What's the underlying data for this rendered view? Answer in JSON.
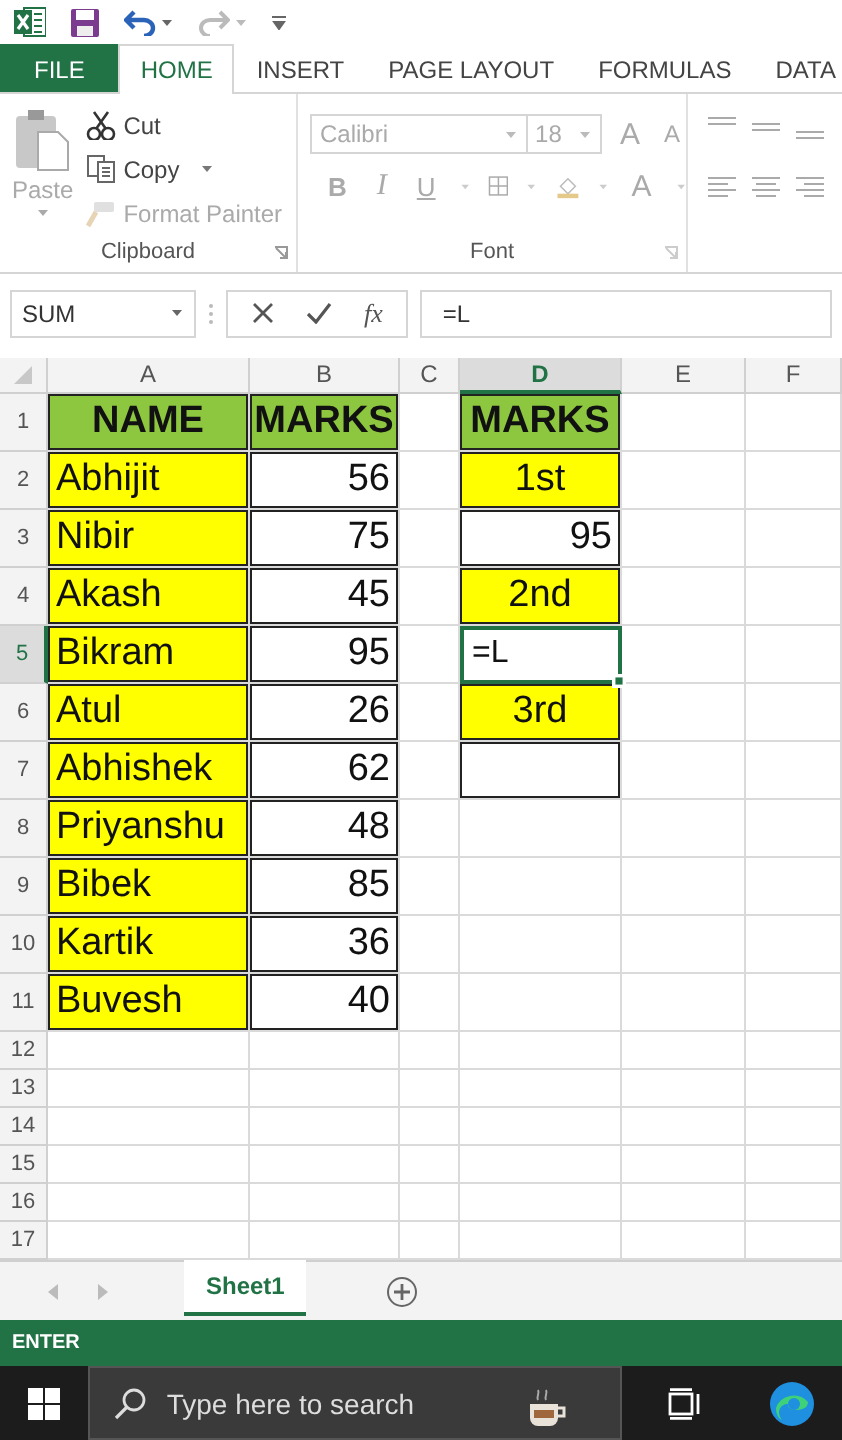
{
  "tabs": [
    {
      "label": "FILE",
      "kind": "file",
      "selected": false
    },
    {
      "label": "HOME",
      "kind": "tab",
      "selected": true
    },
    {
      "label": "INSERT",
      "kind": "tab",
      "selected": false
    },
    {
      "label": "PAGE LAYOUT",
      "kind": "tab",
      "selected": false
    },
    {
      "label": "FORMULAS",
      "kind": "tab",
      "selected": false
    },
    {
      "label": "DATA",
      "kind": "tab",
      "selected": false
    }
  ],
  "clipboard": {
    "label": "Clipboard",
    "paste": {
      "label": "Paste",
      "disabled": true
    },
    "items": [
      {
        "label": "Cut",
        "kind": "cut",
        "disabled": false
      },
      {
        "label": "Copy",
        "kind": "copy",
        "disabled": false
      },
      {
        "label": "Format Painter",
        "kind": "painter",
        "disabled": true
      }
    ]
  },
  "font": {
    "label": "Font",
    "font_name": "Calibri",
    "font_size": "18",
    "grow": "A",
    "shrink": "A",
    "bold": "B",
    "italic": "I",
    "underline": "U",
    "font_color": "A"
  },
  "formula_bar": {
    "name_box": "SUM",
    "fx": "fx",
    "formula": "=L"
  },
  "grid": {
    "columns": [
      {
        "label": "A",
        "selected": false
      },
      {
        "label": "B",
        "selected": false
      },
      {
        "label": "C",
        "selected": false
      },
      {
        "label": "D",
        "selected": true
      },
      {
        "label": "E",
        "selected": false
      },
      {
        "label": "F",
        "selected": false
      }
    ],
    "rows": [
      {
        "label": "1",
        "selected": false,
        "cells": [
          {
            "kind": "header",
            "text": "NAME"
          },
          {
            "kind": "header",
            "text": "MARKS"
          },
          {
            "kind": "blank"
          },
          {
            "kind": "header",
            "text": "MARKS"
          },
          {
            "kind": "blank"
          },
          {
            "kind": "blank"
          }
        ]
      },
      {
        "label": "2",
        "selected": false,
        "cells": [
          {
            "kind": "name",
            "text": "Abhijit"
          },
          {
            "kind": "number",
            "text": "56"
          },
          {
            "kind": "blank"
          },
          {
            "kind": "rank",
            "text": "1st"
          },
          {
            "kind": "blank"
          },
          {
            "kind": "blank"
          }
        ]
      },
      {
        "label": "3",
        "selected": false,
        "cells": [
          {
            "kind": "name",
            "text": "Nibir"
          },
          {
            "kind": "number",
            "text": "75"
          },
          {
            "kind": "blank"
          },
          {
            "kind": "number",
            "text": "95"
          },
          {
            "kind": "blank"
          },
          {
            "kind": "blank"
          }
        ]
      },
      {
        "label": "4",
        "selected": false,
        "cells": [
          {
            "kind": "name",
            "text": "Akash"
          },
          {
            "kind": "number",
            "text": "45"
          },
          {
            "kind": "blank"
          },
          {
            "kind": "rank",
            "text": "2nd"
          },
          {
            "kind": "blank"
          },
          {
            "kind": "blank"
          }
        ]
      },
      {
        "label": "5",
        "selected": true,
        "cells": [
          {
            "kind": "name",
            "text": "Bikram"
          },
          {
            "kind": "number",
            "text": "95"
          },
          {
            "kind": "blank"
          },
          {
            "kind": "editing",
            "text": "=L"
          },
          {
            "kind": "blank"
          },
          {
            "kind": "blank"
          }
        ]
      },
      {
        "label": "6",
        "selected": false,
        "cells": [
          {
            "kind": "name",
            "text": "Atul"
          },
          {
            "kind": "number",
            "text": "26"
          },
          {
            "kind": "blank"
          },
          {
            "kind": "rank",
            "text": "3rd"
          },
          {
            "kind": "blank"
          },
          {
            "kind": "blank"
          }
        ]
      },
      {
        "label": "7",
        "selected": false,
        "cells": [
          {
            "kind": "name",
            "text": "Abhishek"
          },
          {
            "kind": "number",
            "text": "62"
          },
          {
            "kind": "blank"
          },
          {
            "kind": "boxed"
          },
          {
            "kind": "blank"
          },
          {
            "kind": "blank"
          }
        ]
      },
      {
        "label": "8",
        "selected": false,
        "cells": [
          {
            "kind": "name",
            "text": "Priyanshu"
          },
          {
            "kind": "number",
            "text": "48"
          },
          {
            "kind": "blank"
          },
          {
            "kind": "blank"
          },
          {
            "kind": "blank"
          },
          {
            "kind": "blank"
          }
        ]
      },
      {
        "label": "9",
        "selected": false,
        "cells": [
          {
            "kind": "name",
            "text": "Bibek"
          },
          {
            "kind": "number",
            "text": "85"
          },
          {
            "kind": "blank"
          },
          {
            "kind": "blank"
          },
          {
            "kind": "blank"
          },
          {
            "kind": "blank"
          }
        ]
      },
      {
        "label": "10",
        "selected": false,
        "cells": [
          {
            "kind": "name",
            "text": "Kartik"
          },
          {
            "kind": "number",
            "text": "36"
          },
          {
            "kind": "blank"
          },
          {
            "kind": "blank"
          },
          {
            "kind": "blank"
          },
          {
            "kind": "blank"
          }
        ]
      },
      {
        "label": "11",
        "selected": false,
        "cells": [
          {
            "kind": "name",
            "text": "Buvesh"
          },
          {
            "kind": "number",
            "text": "40"
          },
          {
            "kind": "blank"
          },
          {
            "kind": "blank"
          },
          {
            "kind": "blank"
          },
          {
            "kind": "blank"
          }
        ]
      },
      {
        "label": "12",
        "selected": false
      },
      {
        "label": "13",
        "selected": false
      },
      {
        "label": "14",
        "selected": false
      },
      {
        "label": "15",
        "selected": false
      },
      {
        "label": "16",
        "selected": false
      },
      {
        "label": "17",
        "selected": false
      }
    ]
  },
  "sheet_tabs": [
    {
      "label": "Sheet1",
      "selected": true
    }
  ],
  "status_bar": {
    "mode": "ENTER"
  },
  "taskbar": {
    "search_placeholder": "Type here to search"
  }
}
